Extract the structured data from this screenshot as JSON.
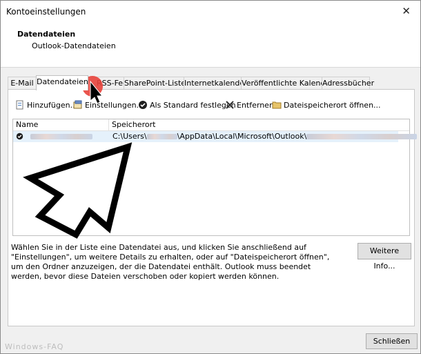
{
  "window": {
    "title": "Kontoeinstellungen",
    "close_glyph": "✕"
  },
  "header": {
    "title": "Datendateien",
    "subtitle": "Outlook-Datendateien"
  },
  "tabs": [
    {
      "label": "E-Mail",
      "active": false
    },
    {
      "label": "Datendateien",
      "active": true
    },
    {
      "label": "RSS-Feeds",
      "active": false
    },
    {
      "label": "SharePoint-Listen",
      "active": false
    },
    {
      "label": "Internetkalender",
      "active": false
    },
    {
      "label": "Veröffentlichte Kalender",
      "active": false
    },
    {
      "label": "Adressbücher",
      "active": false
    }
  ],
  "toolbar": {
    "add_label": "Hinzufügen...",
    "settings_label": "Einstellungen...",
    "default_label": "Als Standard festlegen",
    "remove_label": "Entfernen",
    "open_location_label": "Dateispeicherort öffnen..."
  },
  "list": {
    "col_name": "Name",
    "col_location": "Speicherort",
    "rows": [
      {
        "location_prefix": "C:\\Users\\",
        "location_mid": "\\AppData\\Local\\Microsoft\\Outlook\\"
      }
    ]
  },
  "description": "Wählen Sie in der Liste eine Datendatei aus, und klicken Sie anschließend auf \"Einstellungen\", um weitere Details zu erhalten, oder auf \"Dateispeicherort öffnen\", um den Ordner anzuzeigen, der die Datendatei enthält. Outlook muss beendet werden, bevor diese Dateien verschoben oder kopiert werden können.",
  "buttons": {
    "more_info": "Weitere Info...",
    "close": "Schließen"
  },
  "watermark": "Windows-FAQ",
  "colors": {
    "selection": "#e5f1fb",
    "accent_cursor": "#e8433b"
  }
}
